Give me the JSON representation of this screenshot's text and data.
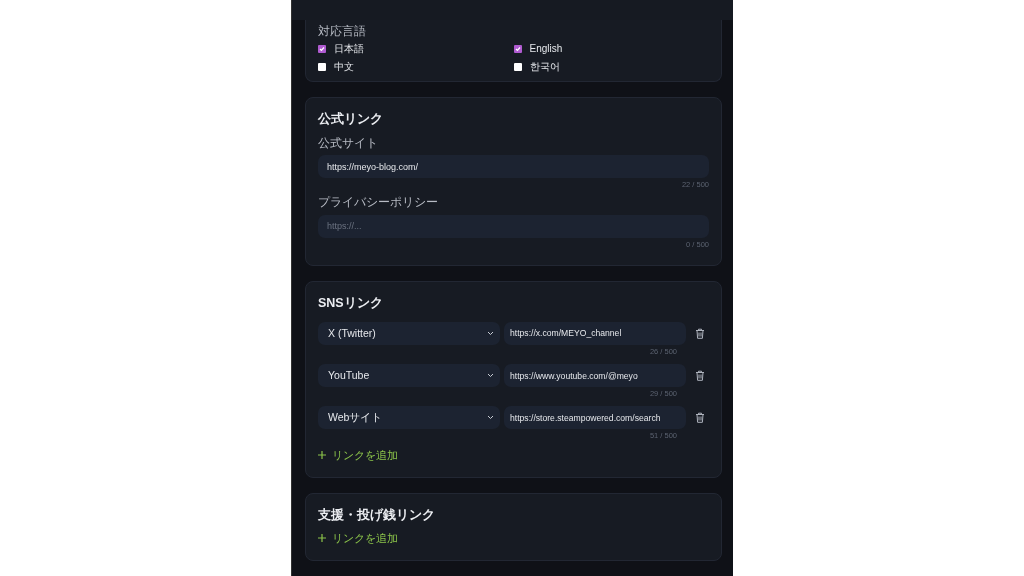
{
  "languages": {
    "label": "対応言語",
    "options": [
      {
        "label": "日本語",
        "checked": true
      },
      {
        "label": "English",
        "checked": true
      },
      {
        "label": "中文",
        "checked": false
      },
      {
        "label": "한국어",
        "checked": false
      }
    ]
  },
  "official_links": {
    "title": "公式リンク",
    "fields": [
      {
        "label": "公式サイト",
        "value": "https://meyo-blog.com/",
        "counter": "22 / 500"
      },
      {
        "label": "プライバシーポリシー",
        "placeholder": "https://...",
        "counter": "0 / 500"
      }
    ]
  },
  "sns_links": {
    "title": "SNSリンク",
    "rows": [
      {
        "platform": "X (Twitter)",
        "url": "https://x.com/MEYO_channel",
        "counter": "26 / 500"
      },
      {
        "platform": "YouTube",
        "url": "https://www.youtube.com/@meyo",
        "counter": "29 / 500"
      },
      {
        "platform": "Webサイト",
        "url": "https://store.steampowered.com/search",
        "counter": "51 / 500"
      }
    ],
    "add_button": "リンクを追加"
  },
  "support_links": {
    "title": "支援・投げ銭リンク",
    "add_button": "リンクを追加"
  }
}
